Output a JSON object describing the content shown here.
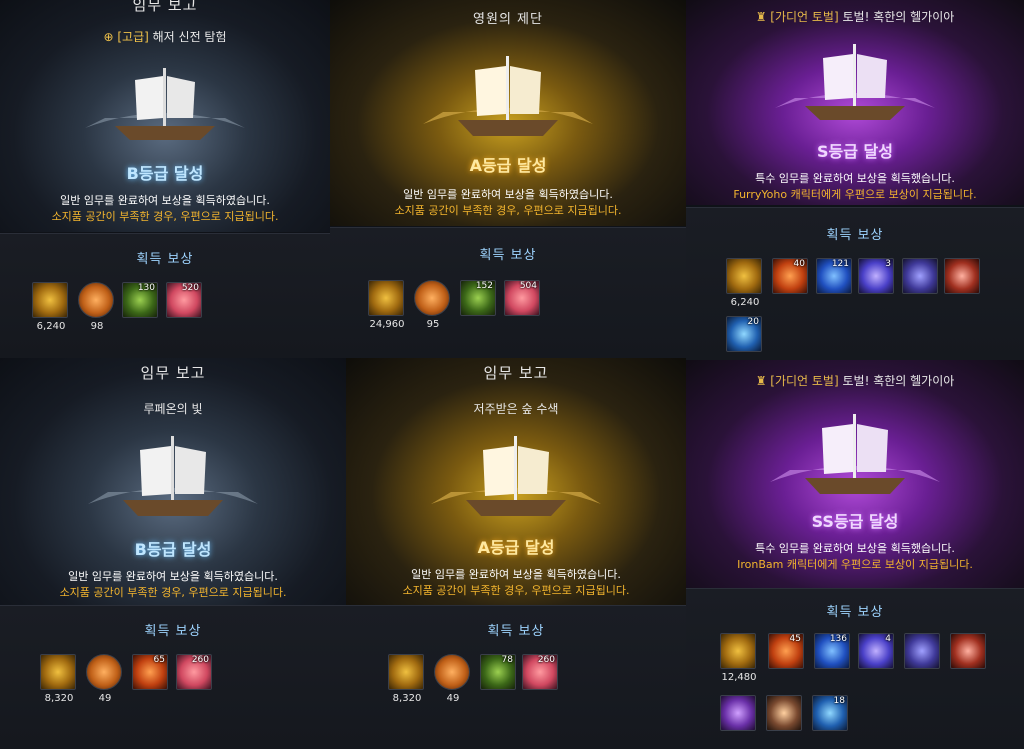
{
  "panels": [
    {
      "header": "임무 보고",
      "subtitle_prefix": "[고급]",
      "subtitle": "해저 신전 탐험",
      "grade": "B등급 달성",
      "message": "일반 임무를 완료하여 보상을 획득하였습니다.",
      "note": "소지품 공간이 부족한 경우, 우편으로 지급됩니다.",
      "reward_title": "획득 보상",
      "items": [
        {
          "icon": "emblem-icon",
          "below": "6,240"
        },
        {
          "icon": "coin-icon",
          "below": "98"
        },
        {
          "icon": "green-pouch-icon",
          "count": "130"
        },
        {
          "icon": "heart-gem-icon",
          "count": "520"
        }
      ]
    },
    {
      "header": "영원의 제단",
      "grade": "A등급 달성",
      "message": "일반 임무를 완료하여 보상을 획득하였습니다.",
      "note": "소지품 공간이 부족한 경우, 우편으로 지급됩니다.",
      "reward_title": "획득 보상",
      "items": [
        {
          "icon": "emblem-icon",
          "below": "24,960"
        },
        {
          "icon": "coin-icon",
          "below": "95"
        },
        {
          "icon": "green-pouch-icon",
          "count": "152"
        },
        {
          "icon": "heart-gem-icon",
          "count": "504"
        }
      ]
    },
    {
      "header_prefix": "[가디언 토벌]",
      "header": "토벌! 혹한의 헬가이아",
      "grade": "S등급 달성",
      "message": "특수 임무를 완료하여 보상을 획득했습니다.",
      "note": "FurryYoho 캐릭터에게 우편으로 보상이 지급됩니다.",
      "reward_title": "획득 보상",
      "items": [
        {
          "icon": "emblem-icon",
          "below": "6,240"
        },
        {
          "icon": "red-chest-icon",
          "count": "40"
        },
        {
          "icon": "blue-crystal-icon",
          "count": "121"
        },
        {
          "icon": "blue-shard-icon",
          "count": "3"
        },
        {
          "icon": "purple-box-icon"
        },
        {
          "icon": "chain-icon"
        },
        {
          "icon": "blue-gem-icon",
          "count": "20"
        }
      ]
    },
    {
      "header": "임무 보고",
      "subtitle": "루페온의 빛",
      "grade": "B등급 달성",
      "message": "일반 임무를 완료하여 보상을 획득하였습니다.",
      "note": "소지품 공간이 부족한 경우, 우편으로 지급됩니다.",
      "reward_title": "획득 보상",
      "items": [
        {
          "icon": "emblem-icon",
          "below": "8,320"
        },
        {
          "icon": "coin-icon",
          "below": "49"
        },
        {
          "icon": "red-pouch-icon",
          "count": "65"
        },
        {
          "icon": "heart-gem-icon",
          "count": "260"
        }
      ]
    },
    {
      "header": "임무 보고",
      "subtitle": "저주받은 숲 수색",
      "grade": "A등급 달성",
      "message": "일반 임무를 완료하여 보상을 획득하였습니다.",
      "note": "소지품 공간이 부족한 경우, 우편으로 지급됩니다.",
      "reward_title": "획득 보상",
      "items": [
        {
          "icon": "emblem-icon",
          "below": "8,320"
        },
        {
          "icon": "coin-icon",
          "below": "49"
        },
        {
          "icon": "green-pouch-icon",
          "count": "78"
        },
        {
          "icon": "heart-gem-icon",
          "count": "260"
        }
      ]
    },
    {
      "header_prefix": "[가디언 토벌]",
      "header": "토벌! 혹한의 헬가이아",
      "grade": "SS등급 달성",
      "message": "특수 임무를 완료하여 보상을 획득했습니다.",
      "note": "IronBam 캐릭터에게 우편으로 보상이 지급됩니다.",
      "reward_title": "획득 보상",
      "items": [
        {
          "icon": "emblem-icon",
          "below": "12,480"
        },
        {
          "icon": "red-chest-icon",
          "count": "45"
        },
        {
          "icon": "blue-crystal-icon",
          "count": "136"
        },
        {
          "icon": "blue-shard-icon",
          "count": "4"
        },
        {
          "icon": "purple-box-icon"
        },
        {
          "icon": "chain-icon"
        },
        {
          "icon": "purple-chest-icon"
        },
        {
          "icon": "card-icon"
        },
        {
          "icon": "blue-gem-icon",
          "count": "18"
        }
      ]
    }
  ]
}
